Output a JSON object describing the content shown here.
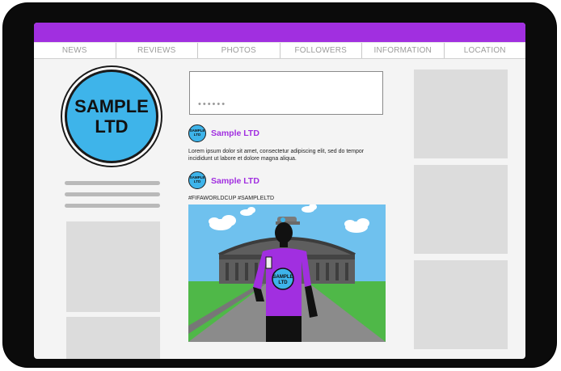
{
  "nav": {
    "tabs": [
      "NEWS",
      "REVIEWS",
      "PHOTOS",
      "FOLLOWERS",
      "INFORMATION",
      "LOCATION"
    ]
  },
  "profile": {
    "logo_line1": "SAMPLE",
    "logo_line2": "LTD"
  },
  "composer": {
    "placeholder": "••••••"
  },
  "posts": [
    {
      "author": "Sample LTD",
      "avatar_line1": "SAMPLE",
      "avatar_line2": "LTD",
      "text": "Lorem ipsum dolor sit amet, consectetur adipiscing elit, sed do tempor incididunt ut labore et dolore magna aliqua."
    },
    {
      "author": "Sample LTD",
      "avatar_line1": "SAMPLE",
      "avatar_line2": "LTD",
      "text": "#FIFAWORLDCUP #SAMPLELTD",
      "shirt_badge_line1": "SAMPLE",
      "shirt_badge_line2": "LTD"
    }
  ],
  "colors": {
    "accent": "#a12fe0",
    "logo_blue": "#3eb4ea",
    "sky": "#6fc1ee",
    "grass": "#4fb848"
  }
}
